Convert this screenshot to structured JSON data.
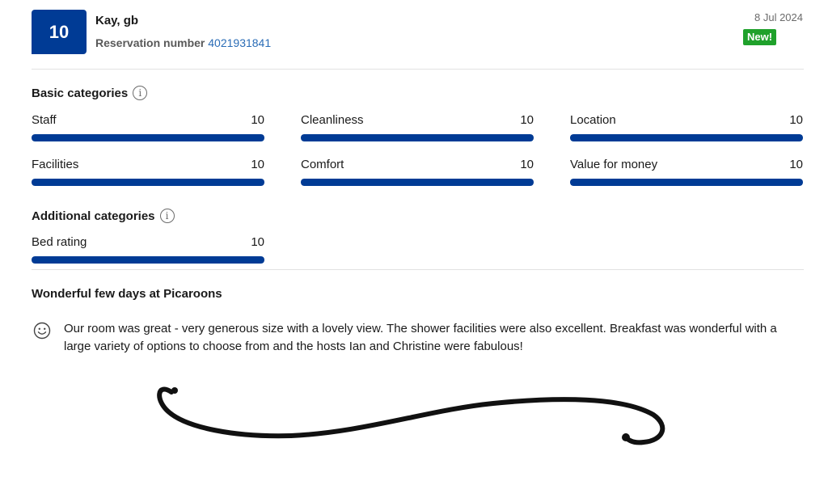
{
  "review": {
    "score": "10",
    "reviewer_name": "Kay, gb",
    "reservation_label": "Reservation number",
    "reservation_number": "4021931841",
    "date": "8 Jul 2024",
    "badge": "New!",
    "badge_color": "#1fa12b",
    "accent_color": "#003b95",
    "title": "Wonderful few days at Picaroons",
    "sentiment_icon": "smile-icon",
    "text": "Our room was great - very generous size with a lovely view. The shower facilities were also excellent. Breakfast was wonderful with a large variety of options to choose from and the hosts Ian and Christine were fabulous!"
  },
  "basic_categories": {
    "heading": "Basic categories",
    "items": [
      {
        "label": "Staff",
        "score": "10",
        "fill_percent": 100
      },
      {
        "label": "Cleanliness",
        "score": "10",
        "fill_percent": 100
      },
      {
        "label": "Location",
        "score": "10",
        "fill_percent": 100
      },
      {
        "label": "Facilities",
        "score": "10",
        "fill_percent": 100
      },
      {
        "label": "Comfort",
        "score": "10",
        "fill_percent": 100
      },
      {
        "label": "Value for money",
        "score": "10",
        "fill_percent": 100
      }
    ]
  },
  "additional_categories": {
    "heading": "Additional categories",
    "items": [
      {
        "label": "Bed rating",
        "score": "10",
        "fill_percent": 100
      }
    ]
  }
}
